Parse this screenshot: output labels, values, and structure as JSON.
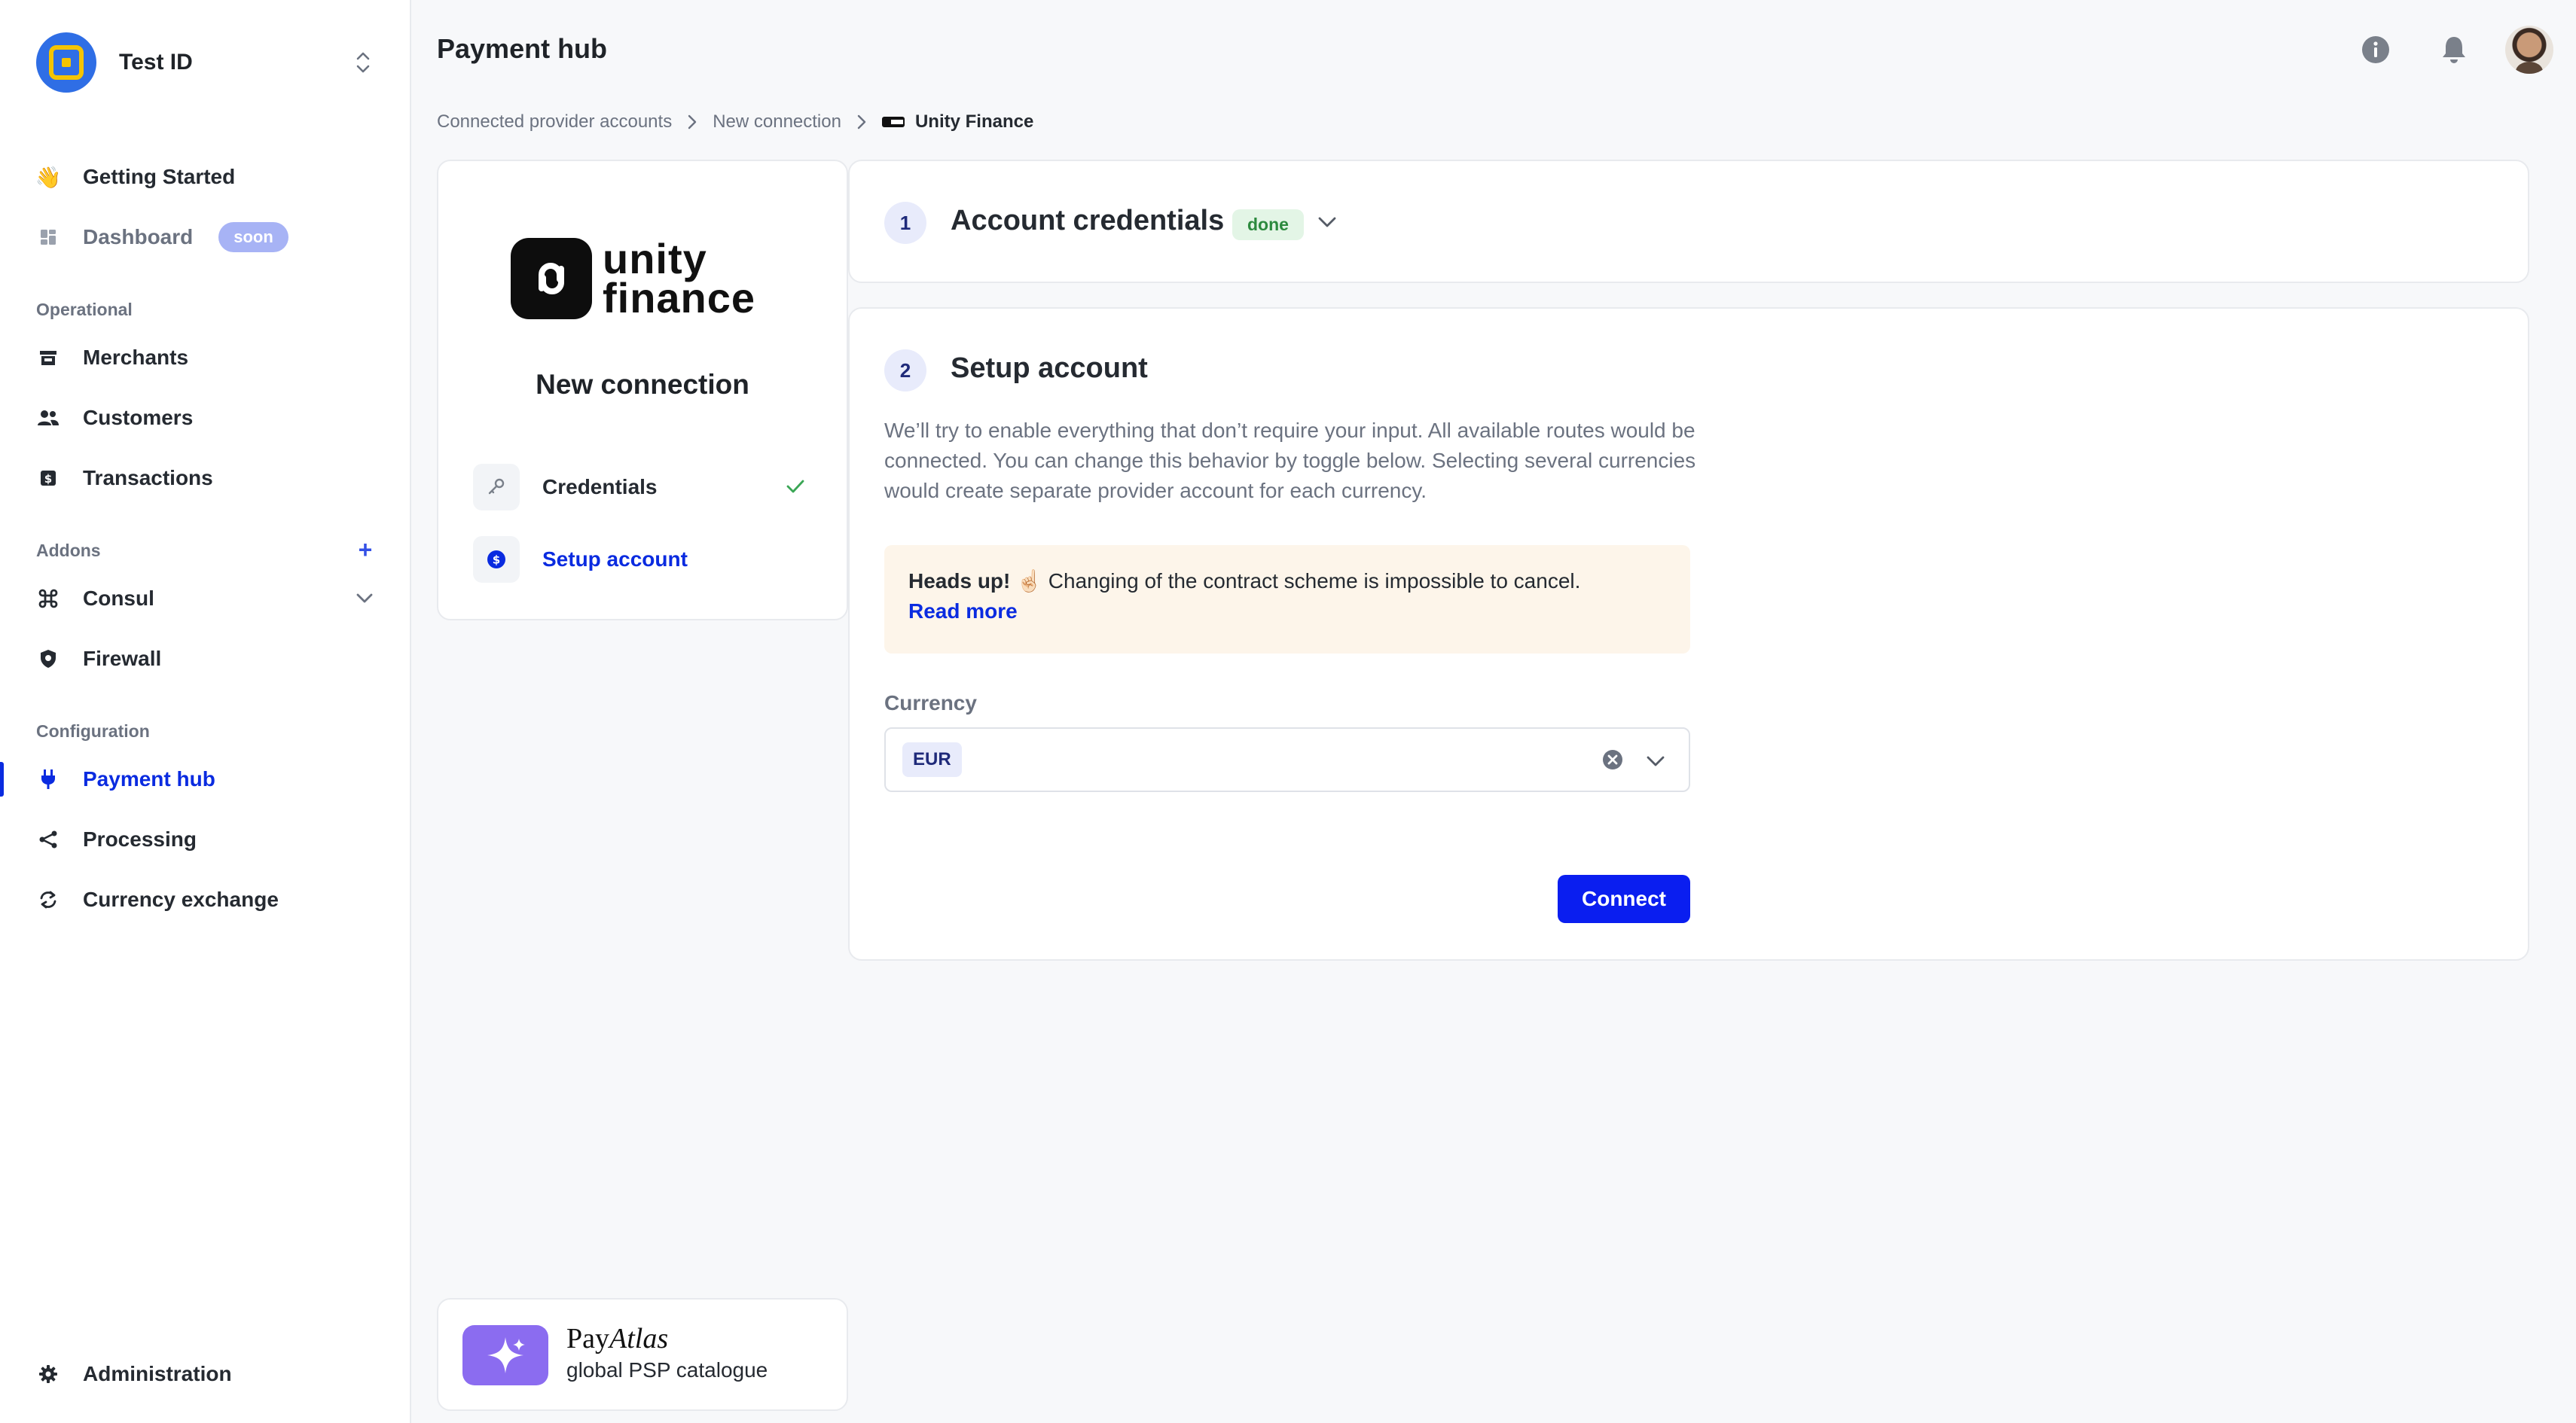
{
  "org": {
    "name": "Test ID"
  },
  "sidebar": {
    "top_items": [
      {
        "label": "Getting Started"
      },
      {
        "label": "Dashboard",
        "badge": "soon"
      }
    ],
    "sections": {
      "operational": "Operational",
      "addons": "Addons",
      "configuration": "Configuration"
    },
    "operational_items": [
      {
        "label": "Merchants"
      },
      {
        "label": "Customers"
      },
      {
        "label": "Transactions"
      }
    ],
    "addon_items": [
      {
        "label": "Consul"
      },
      {
        "label": "Firewall"
      }
    ],
    "configuration_items": [
      {
        "label": "Payment hub"
      },
      {
        "label": "Processing"
      },
      {
        "label": "Currency exchange"
      }
    ],
    "footer_item": {
      "label": "Administration"
    }
  },
  "header": {
    "title": "Payment hub"
  },
  "breadcrumb": {
    "items": [
      "Connected provider accounts",
      "New connection"
    ],
    "current": "Unity Finance"
  },
  "connection_card": {
    "logo_text_line1": "unity",
    "logo_text_line2": "finance",
    "title": "New connection",
    "steps": [
      {
        "label": "Credentials",
        "status": "complete"
      },
      {
        "label": "Setup account",
        "status": "active"
      }
    ]
  },
  "panel1": {
    "number": "1",
    "title": "Account credentials",
    "badge": "done"
  },
  "panel2": {
    "number": "2",
    "title": "Setup account",
    "description": "We’ll try to enable everything that don’t require your input. All available routes would be connected. You can change this behavior by toggle below. Selecting several currencies would create separate provider account for each currency.",
    "alert": {
      "heading": "Heads up!",
      "emoji": "☝🏻",
      "text": "Changing of the contract scheme is impossible to cancel.",
      "link": "Read more"
    },
    "currency_label": "Currency",
    "currency_value": "EUR",
    "connect_label": "Connect"
  },
  "promo": {
    "title_plain": "Pay",
    "title_italic": "Atlas",
    "subtitle": "global PSP catalogue"
  },
  "colors": {
    "accent": "#0a2be0",
    "button": "#0a1ef0",
    "done_bg": "#e3f5e6",
    "done_fg": "#2c8a3e",
    "alert_bg": "#fdf5ea",
    "badge_soon": "#a7b3f5"
  }
}
